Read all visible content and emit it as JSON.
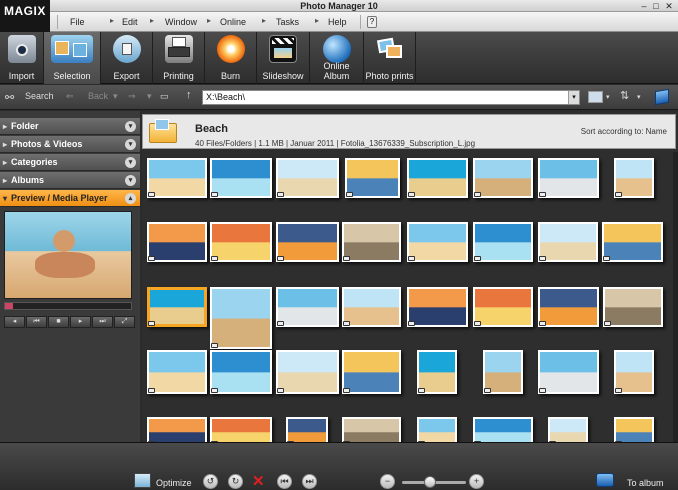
{
  "window": {
    "title": "Photo Manager 10"
  },
  "brand": {
    "logo": "MAGIX"
  },
  "menu": [
    "File",
    "Edit",
    "Window",
    "Online",
    "Tasks",
    "Help"
  ],
  "toolbar": [
    {
      "label": "Import",
      "icon": "camera-icon"
    },
    {
      "label": "Selection",
      "icon": "selection-icon"
    },
    {
      "label": "Export",
      "icon": "export-icon"
    },
    {
      "label": "Printing",
      "icon": "printer-icon"
    },
    {
      "label": "Burn",
      "icon": "burn-disc-icon"
    },
    {
      "label": "Slideshow",
      "icon": "clapperboard-icon"
    },
    {
      "label": "Online Album",
      "icon": "globe-book-icon"
    },
    {
      "label": "Photo prints",
      "icon": "photo-prints-icon"
    }
  ],
  "nav": {
    "search": "Search",
    "back": "Back",
    "path": "X:\\Beach\\"
  },
  "sidebar": {
    "panels": [
      "Folder",
      "Photos & Videos",
      "Categories",
      "Albums",
      "Preview / Media Player"
    ]
  },
  "content": {
    "folder_name": "Beach",
    "folder_info": "40 Files/Folders | 1.1 MB | Januar 2011 | Fotolia_13676339_Subscription_L.jpg",
    "sort_label": "Sort according to: Name"
  },
  "bottom": {
    "optimize": "Optimize",
    "to_album": "To album"
  },
  "colors": {
    "accent": "#f6a623",
    "toolbar": "#3a3a3a",
    "background": "#2e2e2e"
  }
}
